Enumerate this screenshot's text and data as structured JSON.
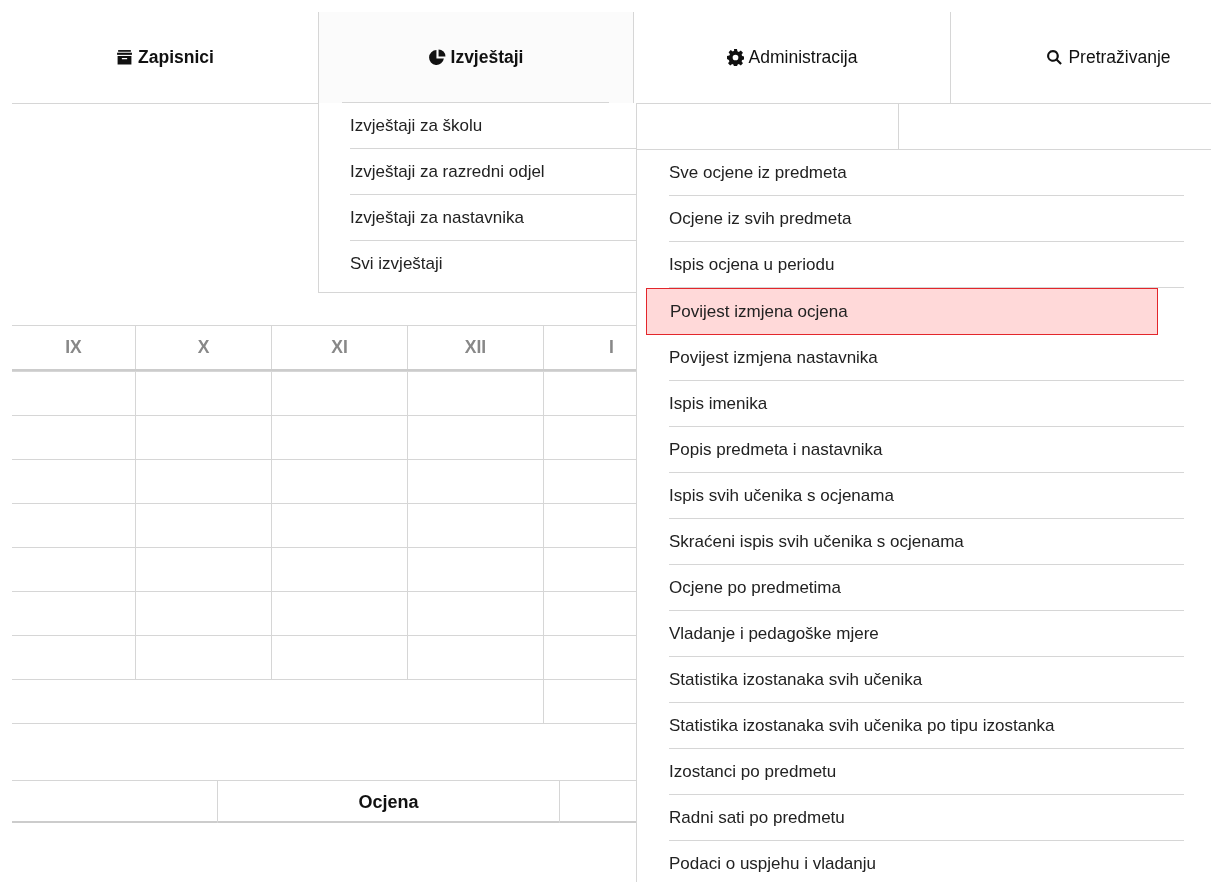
{
  "nav_tabs": [
    {
      "label": "Zapisnici",
      "bold": true,
      "selected": false
    },
    {
      "label": "Izvještaji",
      "bold": true,
      "selected": true
    },
    {
      "label": "Administracija",
      "bold": false,
      "selected": false
    },
    {
      "label": "Pretraživanje",
      "bold": false,
      "selected": false
    }
  ],
  "reports_menu": {
    "items": [
      {
        "label": "Izvještaji za školu"
      },
      {
        "label": "Izvještaji za razredni odjel"
      },
      {
        "label": "Izvještaji za nastavnika"
      },
      {
        "label": "Svi izvještaji"
      }
    ]
  },
  "submenu": {
    "items": [
      {
        "label": "Sve ocjene iz predmeta",
        "selected": false
      },
      {
        "label": "Ocjene iz svih predmeta",
        "selected": false
      },
      {
        "label": "Ispis ocjena u periodu",
        "selected": false
      },
      {
        "label": "Povijest izmjena ocjena",
        "selected": true
      },
      {
        "label": "Povijest izmjena nastavnika",
        "selected": false
      },
      {
        "label": "Ispis imenika",
        "selected": false
      },
      {
        "label": "Popis predmeta i nastavnika",
        "selected": false
      },
      {
        "label": "Ispis svih učenika s ocjenama",
        "selected": false
      },
      {
        "label": "Skraćeni ispis svih učenika s ocjenama",
        "selected": false
      },
      {
        "label": "Ocjene po predmetima",
        "selected": false
      },
      {
        "label": "Vladanje i pedagoške mjere",
        "selected": false
      },
      {
        "label": "Statistika izostanaka svih učenika",
        "selected": false
      },
      {
        "label": "Statistika izostanaka svih učenika po tipu izostanka",
        "selected": false
      },
      {
        "label": "Izostanci po predmetu",
        "selected": false
      },
      {
        "label": "Radni sati po predmetu",
        "selected": false
      },
      {
        "label": "Podaci o uspjehu i vladanju",
        "selected": false
      }
    ]
  },
  "grades_table": {
    "columns": [
      "IX",
      "X",
      "XI",
      "XII",
      "I"
    ],
    "footer_header": "Ocjena"
  }
}
